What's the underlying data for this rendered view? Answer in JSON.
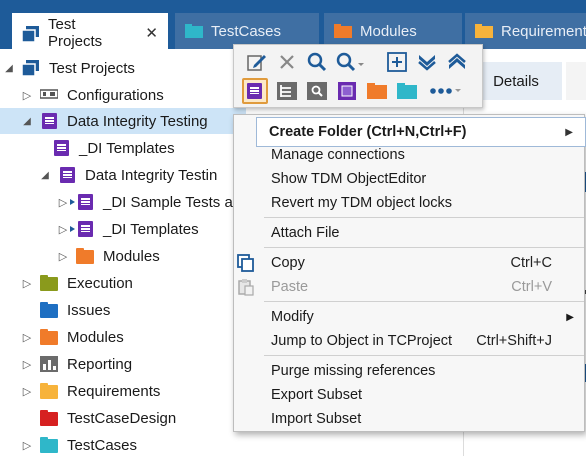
{
  "tabs": [
    {
      "label": "Test Projects",
      "active": true,
      "close": "✕",
      "color": "#1e5b99"
    },
    {
      "label": "TestCases",
      "active": false,
      "color": "#2fb7c9"
    },
    {
      "label": "Modules",
      "active": false,
      "color": "#f07b2a"
    },
    {
      "label": "Requirements",
      "active": false,
      "color": "#f7b33b"
    }
  ],
  "tree": {
    "root": "Test Projects",
    "items": [
      {
        "label": "Configurations"
      },
      {
        "label": "Data Integrity Testing"
      },
      {
        "label": "_DI Templates"
      },
      {
        "label": "Data Integrity Testin"
      },
      {
        "label": "_DI Sample Tests a"
      },
      {
        "label": "_DI Templates"
      },
      {
        "label": "Modules"
      },
      {
        "label": "Execution"
      },
      {
        "label": "Issues"
      },
      {
        "label": "Modules"
      },
      {
        "label": "Reporting"
      },
      {
        "label": "Requirements"
      },
      {
        "label": "TestCaseDesign"
      },
      {
        "label": "TestCases"
      }
    ]
  },
  "details": {
    "tab_label": "Details"
  },
  "toolbar": {
    "icons": [
      "edit-icon",
      "delete-icon",
      "search-icon",
      "search-dropdown-icon",
      "add-icon",
      "collapse-all-icon",
      "expand-all-icon",
      "create-folder-icon",
      "tree-structure-icon",
      "find-folder-icon",
      "module-icon",
      "orange-folder-icon",
      "teal-folder-icon",
      "more-icon"
    ],
    "tooltip": "Create Folder (Ctrl+N,Ctrl+F)"
  },
  "menu": {
    "items": [
      {
        "label": "Manage connections"
      },
      {
        "label": "Show TDM ObjectEditor"
      },
      {
        "label": "Revert my TDM object locks"
      },
      {
        "label": "Attach File"
      },
      {
        "label": "Copy",
        "shortcut": "Ctrl+C"
      },
      {
        "label": "Paste",
        "shortcut": "Ctrl+V",
        "disabled": true
      },
      {
        "label": "Modify"
      },
      {
        "label": "Jump to Object in TCProject",
        "shortcut": "Ctrl+Shift+J"
      },
      {
        "label": "Purge missing references"
      },
      {
        "label": "Export Subset"
      },
      {
        "label": "Import Subset"
      }
    ]
  },
  "colors": {
    "accent": "#1e5b99",
    "selection": "#cde4f7",
    "purple": "#6a2bb0",
    "orange": "#f07b2a",
    "teal": "#2fb7c9",
    "olive": "#8a9a1c",
    "blue": "#1e6fc2",
    "yellow": "#f7b33b",
    "red": "#d62020",
    "highlight": "#e09b3d"
  }
}
